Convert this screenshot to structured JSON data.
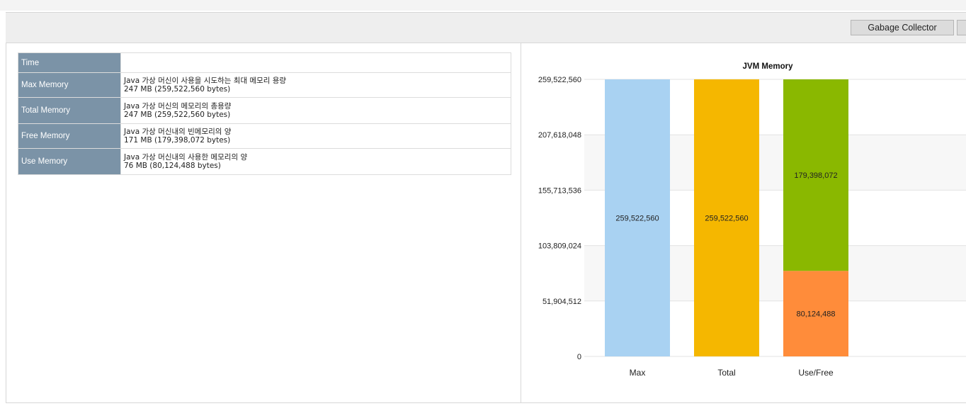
{
  "toolbar": {
    "gc_button": "Gabage Collector"
  },
  "info_table": {
    "rows": [
      {
        "key": "Time",
        "desc": "",
        "value": ""
      },
      {
        "key": "Max Memory",
        "desc": "Java 가상 머신이 사용을 시도하는 최대 메모리 용량",
        "value": "247 MB (259,522,560 bytes)"
      },
      {
        "key": "Total Memory",
        "desc": "Java 가상 머신의 메모리의 총용량",
        "value": "247 MB (259,522,560 bytes)"
      },
      {
        "key": "Free Memory",
        "desc": "Java 가상 머신내의 빈메모리의 양",
        "value": "171 MB (179,398,072 bytes)"
      },
      {
        "key": "Use Memory",
        "desc": "Java 가상 머신내의 사용한 메모리의 양",
        "value": "76 MB (80,124,488 bytes)"
      }
    ]
  },
  "chart_data": {
    "type": "bar",
    "title": "JVM Memory",
    "categories": [
      "Max",
      "Total",
      "Use/Free"
    ],
    "stacked": true,
    "series": [
      {
        "values": [
          259522560,
          259522560,
          80124488
        ],
        "colors": [
          "#a9d2f2",
          "#f5b700",
          "#ff8c3a"
        ],
        "labels": [
          "259,522,560",
          "259,522,560",
          "80,124,488"
        ]
      },
      {
        "values": [
          0,
          0,
          179398072
        ],
        "colors": [
          "#a9d2f2",
          "#f5b700",
          "#8ab800"
        ],
        "labels": [
          "",
          "",
          "179,398,072"
        ]
      }
    ],
    "ylim": [
      0,
      259522560
    ],
    "yticks": [
      0,
      51904512,
      103809024,
      155713536,
      207618048,
      259522560
    ],
    "ytick_labels": [
      "0",
      "51,904,512",
      "103,809,024",
      "155,713,536",
      "207,618,048",
      "259,522,560"
    ],
    "xlabel": "",
    "ylabel": "",
    "grid": true,
    "band_colors": [
      "#ffffff",
      "#f7f7f7"
    ]
  }
}
